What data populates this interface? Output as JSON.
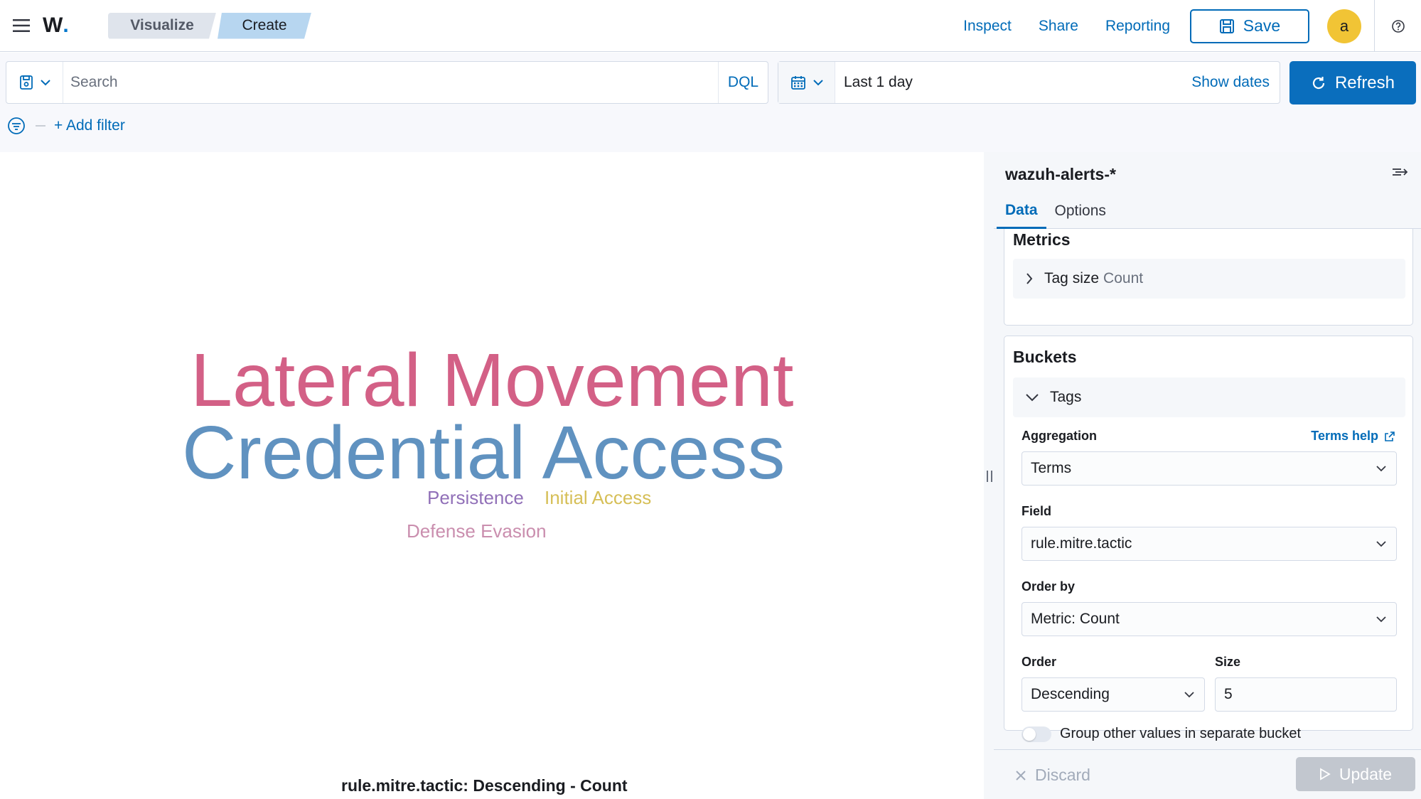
{
  "header": {
    "logo_text": "W",
    "breadcrumbs": [
      "Visualize",
      "Create"
    ],
    "links": [
      "Inspect",
      "Share",
      "Reporting"
    ],
    "save_label": "Save",
    "avatar_initial": "a"
  },
  "query": {
    "search_placeholder": "Search",
    "language": "DQL",
    "date_range": "Last 1 day",
    "show_dates": "Show dates",
    "refresh_label": "Refresh",
    "add_filter": "+ Add filter"
  },
  "visualization": {
    "words": [
      {
        "text": "Lateral Movement",
        "color": "#d36086"
      },
      {
        "text": "Credential Access",
        "color": "#6092c0"
      },
      {
        "text": "Persistence",
        "color": "#9170b8"
      },
      {
        "text": "Initial Access",
        "color": "#d6bf57"
      },
      {
        "text": "Defense Evasion",
        "color": "#ca8eae"
      }
    ],
    "caption": "rule.mitre.tactic: Descending - Count"
  },
  "sidebar": {
    "index_pattern": "wazuh-alerts-*",
    "tabs": [
      "Data",
      "Options"
    ],
    "metrics": {
      "title": "Metrics",
      "item_label": "Tag size",
      "item_value": "Count"
    },
    "buckets": {
      "title": "Buckets",
      "item_label": "Tags",
      "aggregation_label": "Aggregation",
      "aggregation_help": "Terms help",
      "aggregation_value": "Terms",
      "field_label": "Field",
      "field_value": "rule.mitre.tactic",
      "order_by_label": "Order by",
      "order_by_value": "Metric: Count",
      "order_label": "Order",
      "order_value": "Descending",
      "size_label": "Size",
      "size_value": "5",
      "group_other_label": "Group other values in separate bucket"
    },
    "discard_label": "Discard",
    "update_label": "Update"
  },
  "colors": {
    "accent": "#006bb8",
    "primary_button": "#0a6ebd",
    "avatar": "#f1c435"
  }
}
